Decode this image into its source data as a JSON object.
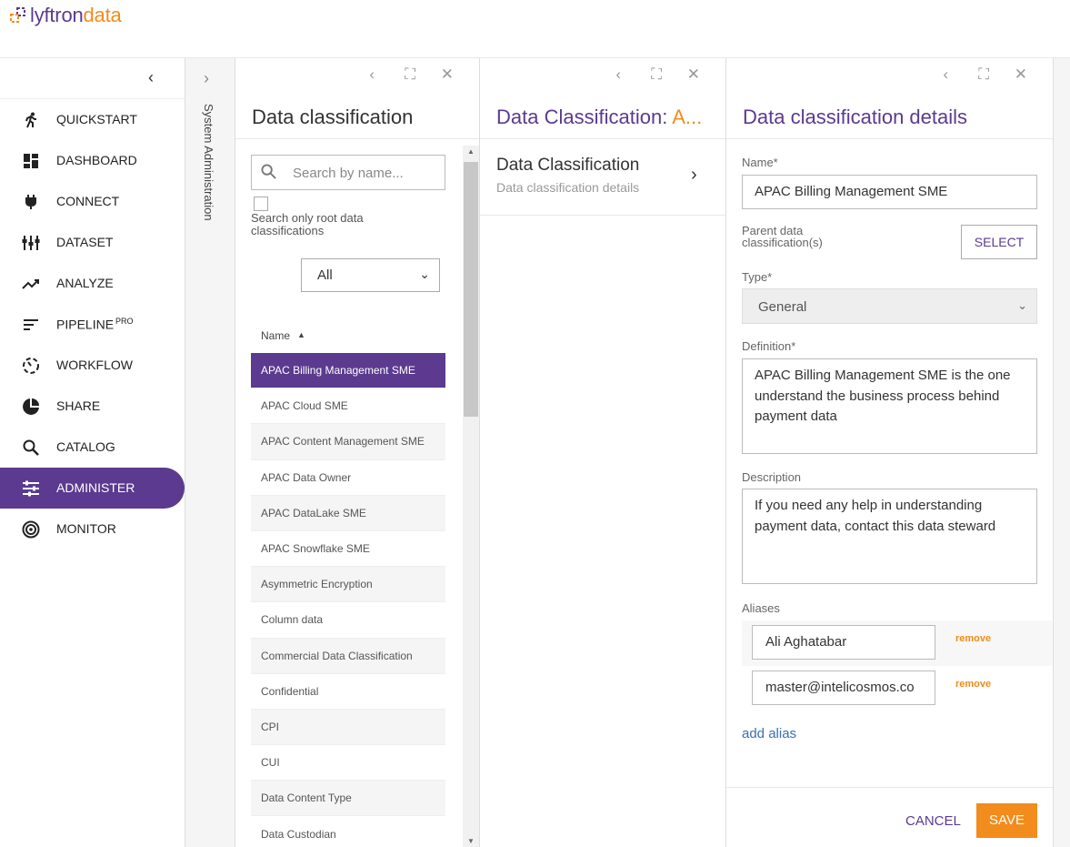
{
  "brand": {
    "logo_a": "lyftron",
    "logo_b": "data"
  },
  "sidebar": {
    "items": [
      {
        "label": "QUICKSTART",
        "icon": "run-icon"
      },
      {
        "label": "DASHBOARD",
        "icon": "dashboard-icon"
      },
      {
        "label": "CONNECT",
        "icon": "plug-icon"
      },
      {
        "label": "DATASET",
        "icon": "dataset-icon"
      },
      {
        "label": "ANALYZE",
        "icon": "trend-icon"
      },
      {
        "label": "PIPELINE",
        "sup": "PRO",
        "icon": "pipeline-icon"
      },
      {
        "label": "WORKFLOW",
        "icon": "workflow-icon"
      },
      {
        "label": "SHARE",
        "icon": "pie-icon"
      },
      {
        "label": "CATALOG",
        "icon": "search-icon"
      },
      {
        "label": "ADMINISTER",
        "icon": "sliders-icon",
        "active": true
      },
      {
        "label": "MONITOR",
        "icon": "monitor-icon"
      }
    ]
  },
  "strip": {
    "label": "System Administration"
  },
  "panel1": {
    "title": "Data classification",
    "search_placeholder": "Search by name...",
    "root_only_label": "Search only root data classifications",
    "filter_value": "All",
    "column_name": "Name",
    "rows": [
      "APAC Billing Management SME",
      "APAC Cloud SME",
      "APAC Content Management SME",
      "APAC Data Owner",
      "APAC DataLake SME",
      "APAC Snowflake SME",
      "Asymmetric Encryption",
      "Column data",
      "Commercial Data Classification",
      "Confidential",
      "CPI",
      "CUI",
      "Data Content Type",
      "Data Custodian"
    ],
    "selected_index": 0
  },
  "panel2": {
    "title_a": "Data Classification: ",
    "title_b": "A...",
    "card_title": "Data Classification",
    "card_subtitle": "Data classification details"
  },
  "panel3": {
    "title": "Data classification details",
    "name_label": "Name*",
    "name_value": "APAC Billing Management SME",
    "parent_label": "Parent data classification(s)",
    "select_label": "SELECT",
    "type_label": "Type*",
    "type_value": "General",
    "definition_label": "Definition*",
    "definition_value": "APAC Billing Management SME is the one understand the business process behind payment data",
    "description_label": "Description",
    "description_value": "If you need any help in understanding payment data, contact this data steward",
    "aliases_label": "Aliases",
    "aliases": [
      "Ali Aghatabar",
      "master@intelicosmos.co"
    ],
    "remove_label": "remove",
    "add_alias_label": "add alias",
    "cancel_label": "CANCEL",
    "save_label": "SAVE"
  },
  "colors": {
    "brand_purple": "#5b3a8f",
    "brand_orange": "#f28c1c"
  }
}
